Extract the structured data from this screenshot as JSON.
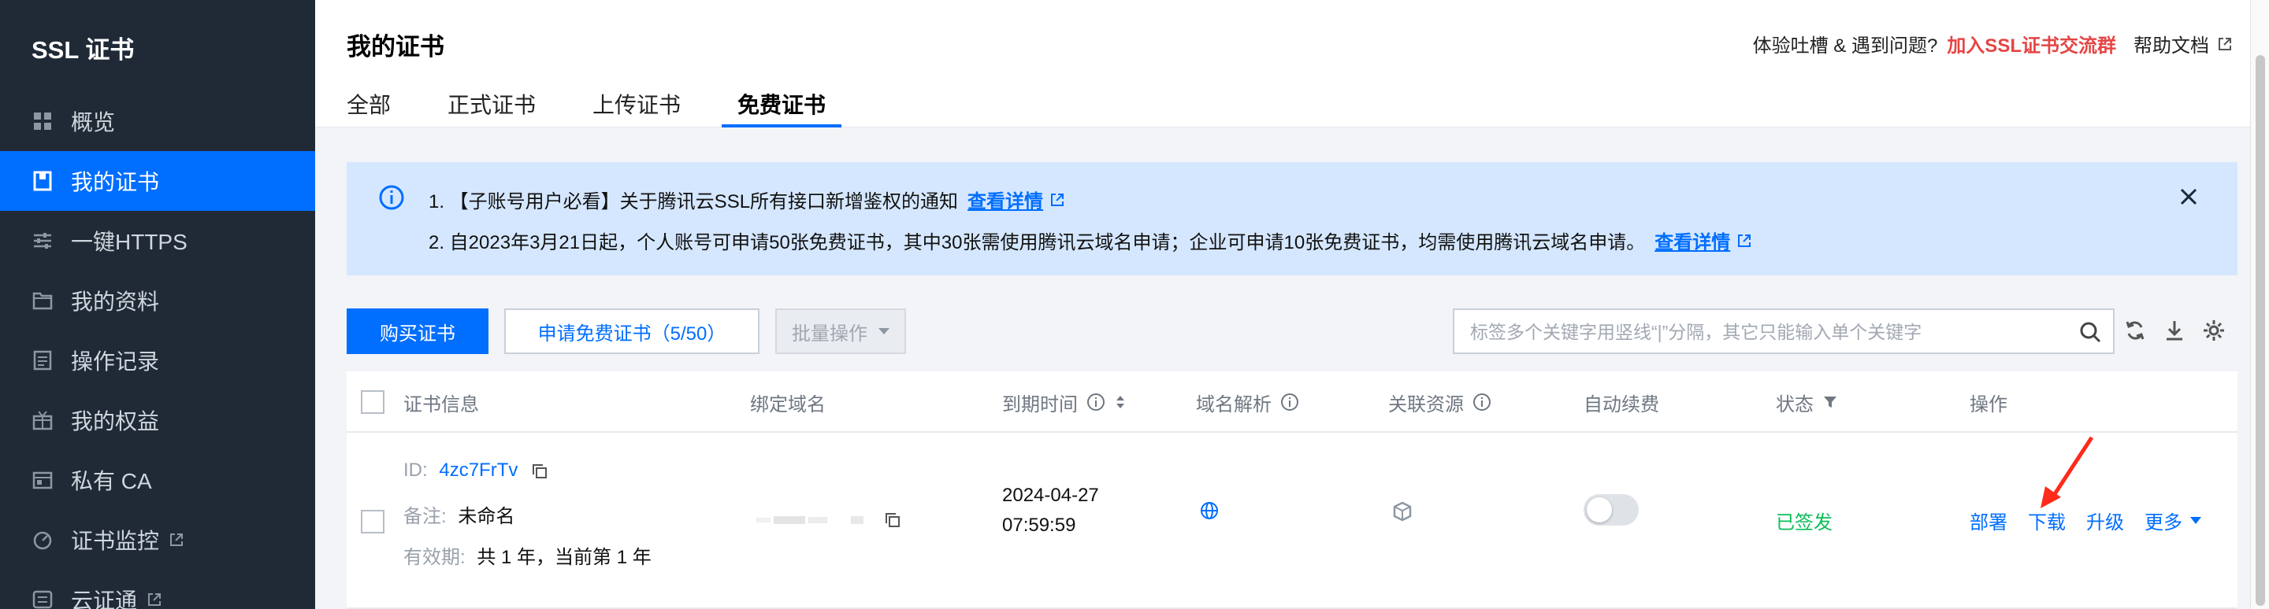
{
  "sidebar": {
    "title": "SSL 证书",
    "items": [
      {
        "label": "概览",
        "icon": "dashboard-icon"
      },
      {
        "label": "我的证书",
        "icon": "certificate-icon",
        "active": true
      },
      {
        "label": "一键HTTPS",
        "icon": "sliders-icon"
      },
      {
        "label": "我的资料",
        "icon": "folder-icon"
      },
      {
        "label": "操作记录",
        "icon": "record-icon"
      },
      {
        "label": "我的权益",
        "icon": "gift-icon"
      },
      {
        "label": "私有 CA",
        "icon": "ca-icon"
      },
      {
        "label": "证书监控",
        "icon": "monitor-icon",
        "external": true
      },
      {
        "label": "云证通",
        "icon": "cloud-cert-icon",
        "external": true
      }
    ]
  },
  "header": {
    "title": "我的证书",
    "feedback": "体验吐槽 & 遇到问题?",
    "join_group": "加入SSL证书交流群",
    "help_doc": "帮助文档",
    "tabs": [
      {
        "label": "全部"
      },
      {
        "label": "正式证书"
      },
      {
        "label": "上传证书"
      },
      {
        "label": "免费证书",
        "active": true
      }
    ]
  },
  "notice": {
    "line1": "1. 【子账号用户必看】关于腾讯云SSL所有接口新增鉴权的通知",
    "line1_link": "查看详情",
    "line2": "2. 自2023年3月21日起，个人账号可申请50张免费证书，其中30张需使用腾讯云域名申请；企业可申请10张免费证书，均需使用腾讯云域名申请。",
    "line2_link": "查看详情"
  },
  "toolbar": {
    "buy_label": "购买证书",
    "apply_label": "申请免费证书（5/50）",
    "batch_label": "批量操作",
    "search_placeholder": "标签多个关键字用竖线“|”分隔，其它只能输入单个关键字"
  },
  "table": {
    "columns": [
      "证书信息",
      "绑定域名",
      "到期时间",
      "域名解析",
      "关联资源",
      "自动续费",
      "状态",
      "操作"
    ],
    "rows": [
      {
        "id_label": "ID:",
        "id_value": "4zc7FrTv",
        "remark_label": "备注:",
        "remark_value": "未命名",
        "validity_label": "有效期:",
        "validity_value": "共 1 年，当前第 1 年",
        "expire_date": "2024-04-27",
        "expire_time": "07:59:59",
        "status": "已签发",
        "actions": [
          "部署",
          "下载",
          "升级",
          "更多"
        ]
      }
    ]
  },
  "colors": {
    "accent": "#006eff",
    "sidebar_bg": "#1f2a36",
    "status_green": "#0abf5b",
    "highlight_red": "#e54545",
    "annotation_arrow": "#ff2a1a"
  }
}
